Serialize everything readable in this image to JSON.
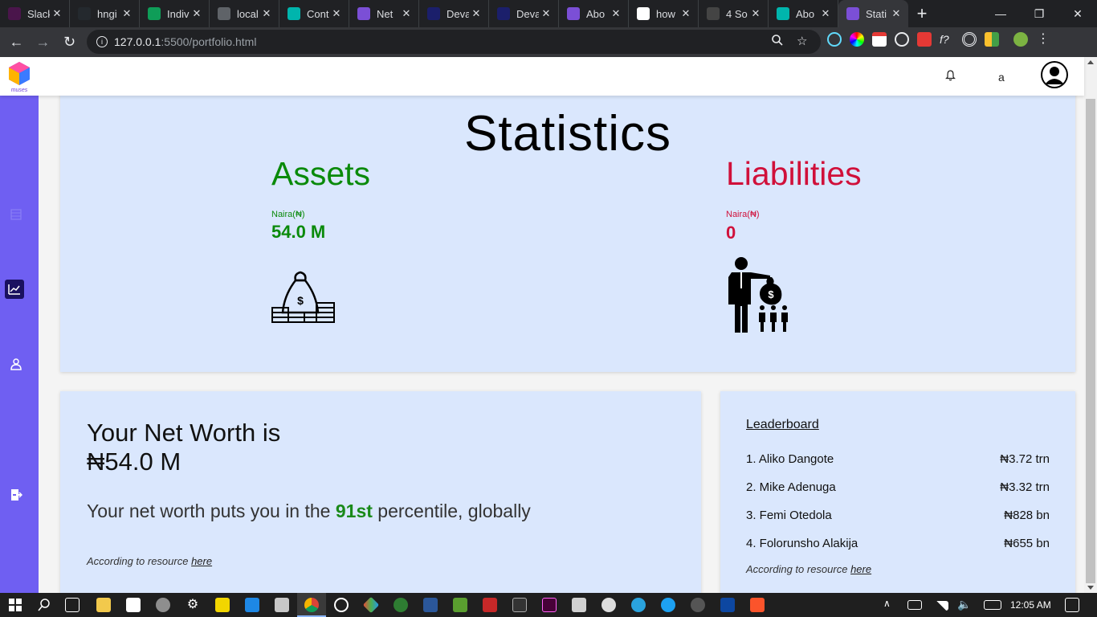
{
  "browser": {
    "tabs": [
      {
        "title": "Slack",
        "color": "#4a154b"
      },
      {
        "title": "hngi",
        "color": "#24292e"
      },
      {
        "title": "Indiv",
        "color": "#0f9d58"
      },
      {
        "title": "local",
        "color": "#5f6368"
      },
      {
        "title": "Cont",
        "color": "#00b5ad"
      },
      {
        "title": "Net",
        "color": "#7b4fd6"
      },
      {
        "title": "Deva",
        "color": "#1b1f6b"
      },
      {
        "title": "Deva",
        "color": "#1b1f6b"
      },
      {
        "title": "Abo",
        "color": "#7b4fd6"
      },
      {
        "title": "how",
        "color": "#ffffff"
      },
      {
        "title": "4 So",
        "color": "#444444"
      },
      {
        "title": "Abo",
        "color": "#00b5ad"
      },
      {
        "title": "Stati",
        "color": "#7b4fd6",
        "active": true
      }
    ],
    "close_glyph": "✕",
    "new_tab_glyph": "+",
    "url_host": "127.0.0.1",
    "url_path": ":5500/portfolio.html"
  },
  "header": {
    "logo_text": "muses",
    "bell_icon": "bell-icon",
    "user_initial": "a"
  },
  "statistics": {
    "title": "Statistics",
    "assets": {
      "title": "Assets",
      "unit": "Naira(₦)",
      "value": "54.0 M",
      "color": "#0a8a0a"
    },
    "liabilities": {
      "title": "Liabilities",
      "unit": "Naira(₦)",
      "value": "0",
      "color": "#d0103a"
    }
  },
  "networth": {
    "title": "Your Net Worth is",
    "value": "₦54.0 M",
    "pct_prefix": "Your net worth puts you in the",
    "pct_value": "91st",
    "pct_suffix": "percentile, globally",
    "source_prefix": "According to resource",
    "source_link": "here"
  },
  "leaderboard": {
    "title": "Leaderboard",
    "rows": [
      {
        "name": "1. Aliko Dangote",
        "value": "₦3.72 trn"
      },
      {
        "name": "2. Mike Adenuga",
        "value": "₦3.32 trn"
      },
      {
        "name": "3. Femi Otedola",
        "value": "₦828 bn"
      },
      {
        "name": "4. Folorunsho Alakija",
        "value": "₦655 bn"
      }
    ],
    "source_prefix": "According to resource",
    "source_link": "here"
  },
  "taskbar": {
    "time": "12:05 AM"
  }
}
